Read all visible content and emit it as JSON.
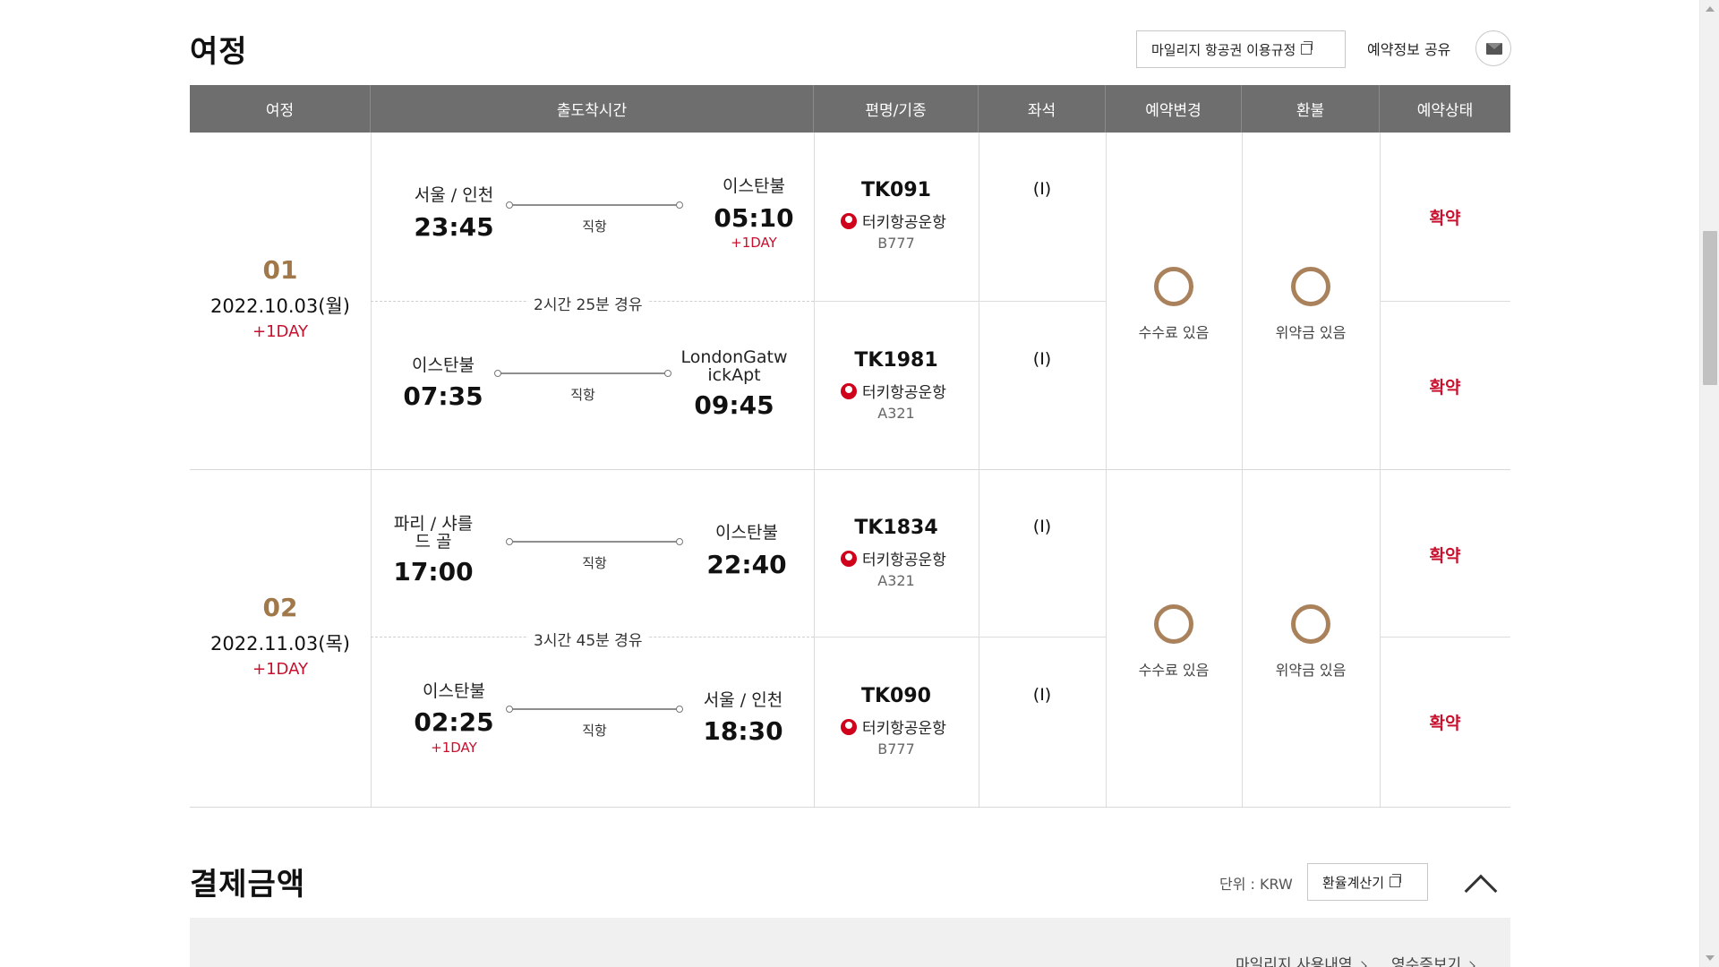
{
  "itinerary": {
    "title": "여정",
    "mileage_rules_button": "마일리지 항공권 이용규정",
    "share_label": "예약정보 공유",
    "columns": [
      "여정",
      "출도착시간",
      "편명/기종",
      "좌석",
      "예약변경",
      "환불",
      "예약상태"
    ],
    "trips": [
      {
        "seq": "01",
        "date": "2022.10.03(월)",
        "plus_day": "+1DAY",
        "segments": [
          {
            "dep_city": "서울 / 인천",
            "dep_time": "23:45",
            "dep_plus": "",
            "route_label": "직항",
            "arr_city": "이스탄불",
            "arr_time": "05:10",
            "arr_plus": "+1DAY",
            "flight_no": "TK091",
            "airline": "터키항공운항",
            "aircraft": "B777",
            "seat": "(I)",
            "status": "확약"
          },
          {
            "dep_city": "이스탄불",
            "dep_time": "07:35",
            "dep_plus": "",
            "route_label": "직항",
            "arr_city": "LondonGatwickApt",
            "arr_time": "09:45",
            "arr_plus": "",
            "flight_no": "TK1981",
            "airline": "터키항공운항",
            "aircraft": "A321",
            "seat": "(I)",
            "status": "확약"
          }
        ],
        "transit": "2시간  25분   경유",
        "change": "수수료 있음",
        "refund": "위약금 있음"
      },
      {
        "seq": "02",
        "date": "2022.11.03(목)",
        "plus_day": "+1DAY",
        "segments": [
          {
            "dep_city": "파리 / 샤를 드 골",
            "dep_time": "17:00",
            "dep_plus": "",
            "route_label": "직항",
            "arr_city": "이스탄불",
            "arr_time": "22:40",
            "arr_plus": "",
            "flight_no": "TK1834",
            "airline": "터키항공운항",
            "aircraft": "A321",
            "seat": "(I)",
            "status": "확약"
          },
          {
            "dep_city": "이스탄불",
            "dep_time": "02:25",
            "dep_plus": "+1DAY",
            "route_label": "직항",
            "arr_city": "서울 / 인천",
            "arr_time": "18:30",
            "arr_plus": "",
            "flight_no": "TK090",
            "airline": "터키항공운항",
            "aircraft": "B777",
            "seat": "(I)",
            "status": "확약"
          }
        ],
        "transit": "3시간  45분   경유",
        "change": "수수료 있음",
        "refund": "위약금 있음"
      }
    ]
  },
  "payment": {
    "title": "결제금액",
    "unit": "단위 : KRW",
    "exchange_button": "환율계산기",
    "mileage_history_link": "마일리지 사용내역",
    "receipt_link": "영수증보기"
  },
  "colors": {
    "header_bg": "#6e6e6e",
    "seq_number": "#a0784a",
    "accent_red": "#c8102e",
    "ring": "#a9825c"
  }
}
